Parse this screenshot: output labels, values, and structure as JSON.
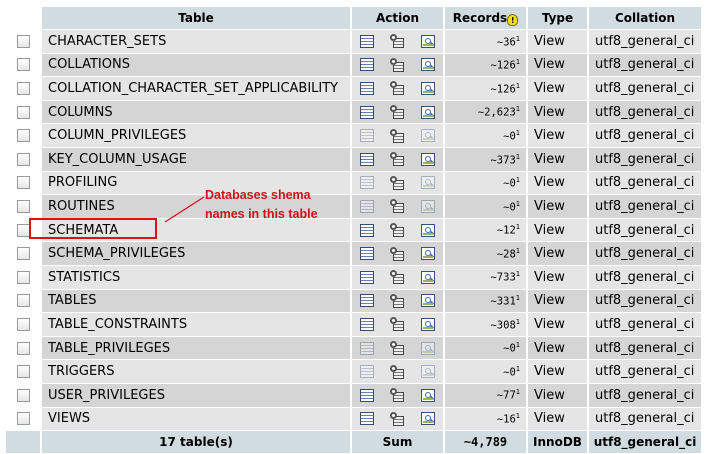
{
  "headers": {
    "table": "Table",
    "action": "Action",
    "records": "Records",
    "type": "Type",
    "collation": "Collation"
  },
  "records_hint_icon": "lightbulb-icon",
  "rows": [
    {
      "name": "CHARACTER_SETS",
      "records": "~36",
      "records_sup": "1",
      "type": "View",
      "collation": "utf8_general_ci",
      "icons_faded": false
    },
    {
      "name": "COLLATIONS",
      "records": "~126",
      "records_sup": "1",
      "type": "View",
      "collation": "utf8_general_ci",
      "icons_faded": false
    },
    {
      "name": "COLLATION_CHARACTER_SET_APPLICABILITY",
      "records": "~126",
      "records_sup": "1",
      "type": "View",
      "collation": "utf8_general_ci",
      "icons_faded": false
    },
    {
      "name": "COLUMNS",
      "records": "~2,623",
      "records_sup": "1",
      "type": "View",
      "collation": "utf8_general_ci",
      "icons_faded": false
    },
    {
      "name": "COLUMN_PRIVILEGES",
      "records": "~0",
      "records_sup": "1",
      "type": "View",
      "collation": "utf8_general_ci",
      "icons_faded": true
    },
    {
      "name": "KEY_COLUMN_USAGE",
      "records": "~373",
      "records_sup": "1",
      "type": "View",
      "collation": "utf8_general_ci",
      "icons_faded": false
    },
    {
      "name": "PROFILING",
      "records": "~0",
      "records_sup": "1",
      "type": "View",
      "collation": "utf8_general_ci",
      "icons_faded": true
    },
    {
      "name": "ROUTINES",
      "records": "~0",
      "records_sup": "1",
      "type": "View",
      "collation": "utf8_general_ci",
      "icons_faded": true
    },
    {
      "name": "SCHEMATA",
      "records": "~12",
      "records_sup": "1",
      "type": "View",
      "collation": "utf8_general_ci",
      "icons_faded": false
    },
    {
      "name": "SCHEMA_PRIVILEGES",
      "records": "~28",
      "records_sup": "1",
      "type": "View",
      "collation": "utf8_general_ci",
      "icons_faded": false
    },
    {
      "name": "STATISTICS",
      "records": "~733",
      "records_sup": "1",
      "type": "View",
      "collation": "utf8_general_ci",
      "icons_faded": false
    },
    {
      "name": "TABLES",
      "records": "~331",
      "records_sup": "1",
      "type": "View",
      "collation": "utf8_general_ci",
      "icons_faded": false
    },
    {
      "name": "TABLE_CONSTRAINTS",
      "records": "~308",
      "records_sup": "1",
      "type": "View",
      "collation": "utf8_general_ci",
      "icons_faded": false
    },
    {
      "name": "TABLE_PRIVILEGES",
      "records": "~0",
      "records_sup": "1",
      "type": "View",
      "collation": "utf8_general_ci",
      "icons_faded": true
    },
    {
      "name": "TRIGGERS",
      "records": "~0",
      "records_sup": "1",
      "type": "View",
      "collation": "utf8_general_ci",
      "icons_faded": true
    },
    {
      "name": "USER_PRIVILEGES",
      "records": "~77",
      "records_sup": "1",
      "type": "View",
      "collation": "utf8_general_ci",
      "icons_faded": false
    },
    {
      "name": "VIEWS",
      "records": "~16",
      "records_sup": "1",
      "type": "View",
      "collation": "utf8_general_ci",
      "icons_faded": false
    }
  ],
  "footer": {
    "count": "17 table(s)",
    "sum_label": "Sum",
    "records_total": "~4,789",
    "engine": "InnoDB",
    "collation": "utf8_general_ci"
  },
  "annotation": {
    "line1": "Databases shema",
    "line2": "names in this table",
    "color": "#d0101a"
  }
}
